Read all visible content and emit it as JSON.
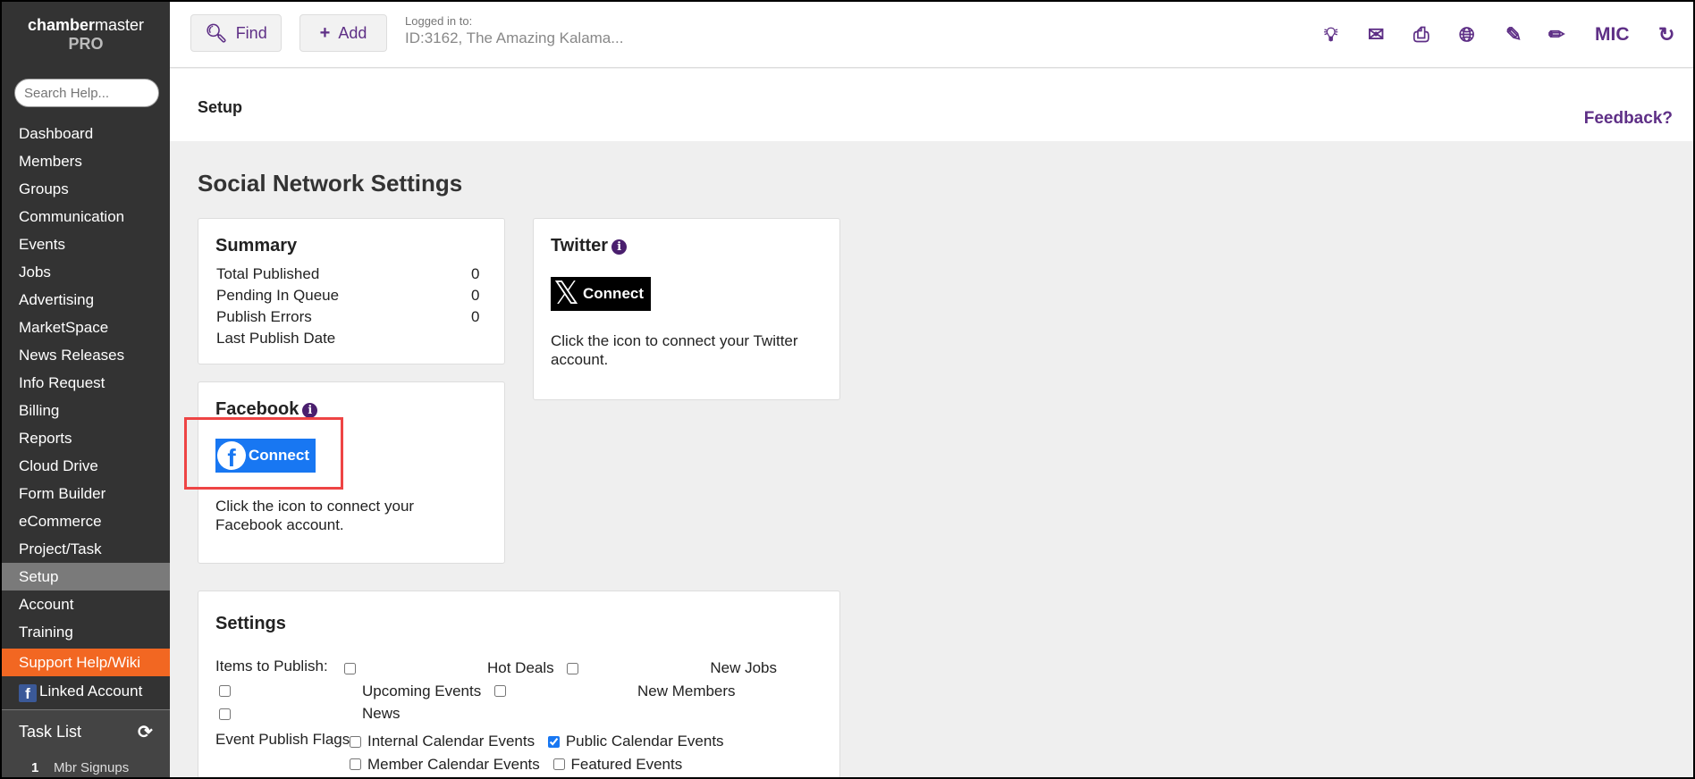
{
  "sidebar": {
    "logo_bold": "chamber",
    "logo_rest": "master",
    "logo_pro": "PRO",
    "search_placeholder": "Search Help...",
    "items": [
      "Dashboard",
      "Members",
      "Groups",
      "Communication",
      "Events",
      "Jobs",
      "Advertising",
      "MarketSpace",
      "News Releases",
      "Info Request",
      "Billing",
      "Reports",
      "Cloud Drive",
      "Form Builder",
      "eCommerce",
      "Project/Task",
      "Setup",
      "Account",
      "Training"
    ],
    "active": "Setup",
    "support": "Support Help/Wiki",
    "linked": "Linked Account",
    "task_list": "Task List",
    "tasks": [
      {
        "count": "1",
        "label": "Mbr Signups"
      }
    ]
  },
  "header": {
    "find": "Find",
    "add": "Add",
    "logged_label": "Logged in to:",
    "logged_value": "ID:3162, The Amazing Kalama...",
    "user": "MIC",
    "icons": [
      "lightbulb-icon",
      "envelope-icon",
      "print-icon",
      "globe-icon",
      "edit-icon",
      "pencil-icon",
      "refresh-icon"
    ]
  },
  "page": {
    "breadcrumb": "Setup",
    "feedback": "Feedback?",
    "title": "Social Network Settings"
  },
  "summary": {
    "title": "Summary",
    "rows": [
      {
        "label": "Total Published",
        "value": "0"
      },
      {
        "label": "Pending In Queue",
        "value": "0"
      },
      {
        "label": "Publish Errors",
        "value": "0"
      },
      {
        "label": "Last Publish Date",
        "value": ""
      }
    ]
  },
  "twitter": {
    "title": "Twitter",
    "connect": "Connect",
    "desc": "Click the icon to connect your Twitter account."
  },
  "facebook": {
    "title": "Facebook",
    "connect": "Connect",
    "desc": "Click the icon to connect your Facebook account."
  },
  "settings": {
    "title": "Settings",
    "items_label": "Items to Publish:",
    "items": [
      {
        "label": "Hot Deals",
        "checked": false
      },
      {
        "label": "New Jobs",
        "checked": false
      },
      {
        "label": "Upcoming Events",
        "checked": false
      },
      {
        "label": "New Members",
        "checked": false
      },
      {
        "label": "News",
        "checked": false
      }
    ],
    "flags_label": "Event Publish Flags:",
    "flags": [
      {
        "label": "Internal Calendar Events",
        "checked": false
      },
      {
        "label": "Public Calendar Events",
        "checked": true
      },
      {
        "label": "Member Calendar Events",
        "checked": false
      },
      {
        "label": "Featured Events",
        "checked": false
      }
    ]
  },
  "colors": {
    "accent": "#5e2f86",
    "orange": "#f26722",
    "sidebar": "#333333",
    "highlight": "#ee4444"
  }
}
